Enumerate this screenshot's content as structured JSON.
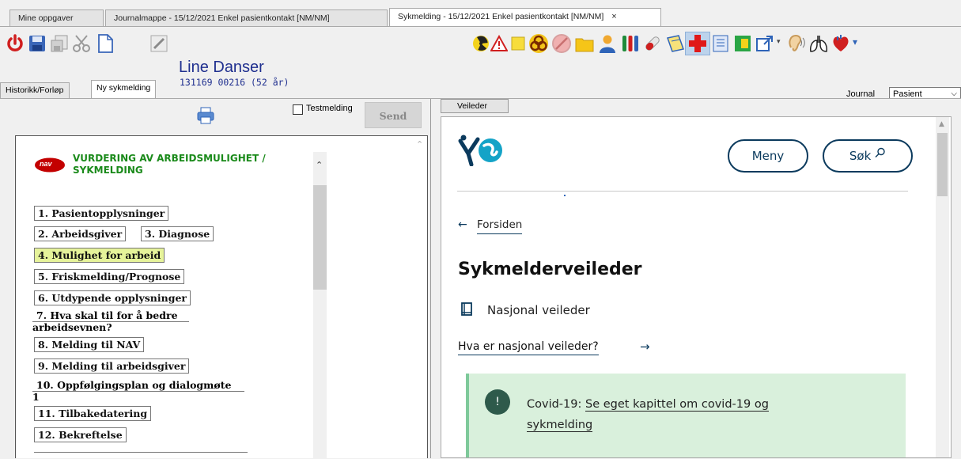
{
  "tabs": [
    {
      "label": "Mine oppgaver"
    },
    {
      "label": "Journalmappe - 15/12/2021 Enkel pasientkontakt [NM/NM]"
    },
    {
      "label": "Sykmelding - 15/12/2021 Enkel pasientkontakt [NM/NM]",
      "close": "×"
    }
  ],
  "patient": {
    "name": "Line Danser",
    "id": "131169 00216 (52 år)"
  },
  "journal": {
    "label": "Journal",
    "value": "Pasient"
  },
  "subtabs": [
    {
      "label": "Historikk/Forløp"
    },
    {
      "label": "Ny sykmelding"
    }
  ],
  "form": {
    "testmelding": "Testmelding",
    "send": "Send",
    "logo": "nav",
    "title_line1": "VURDERING AV ARBEIDSMULIGHET /",
    "title_line2": "SYKMELDING",
    "sections": [
      "1. Pasientopplysninger",
      "2. Arbeidsgiver",
      "3. Diagnose",
      "4. Mulighet for arbeid",
      "5. Friskmelding/Prognose",
      "6. Utdypende opplysninger",
      "7. Hva skal til for å bedre",
      "arbeidsevnen?",
      "8. Melding til NAV",
      "9. Melding til arbeidsgiver",
      "10. Oppfølgingsplan og dialogmøte",
      "1",
      "11. Tilbakedatering",
      "12. Bekreftelse"
    ]
  },
  "guide": {
    "tab": "Veileder",
    "menu": "Meny",
    "search": "Søk",
    "back_arrow": "←",
    "back": "Forsiden",
    "title": "Sykmelderveileder",
    "subtitle": "Nasjonal veileder",
    "link": "Hva er nasjonal veileder?",
    "link_arrow": "→",
    "covid_prefix": "Covid-19:",
    "covid_link1": "Se eget kapittel om covid-19 og",
    "covid_link2": "sykmelding",
    "exclaim": "!"
  },
  "colors": {
    "navy": "#1f2f8f",
    "nav_red": "#c30000",
    "green_title": "#1a8a1a",
    "highlight": "#e6f39a",
    "covid_bg": "#d9f0dc",
    "covid_border": "#7ec99a",
    "hdir_blue": "#0b3a5d"
  }
}
